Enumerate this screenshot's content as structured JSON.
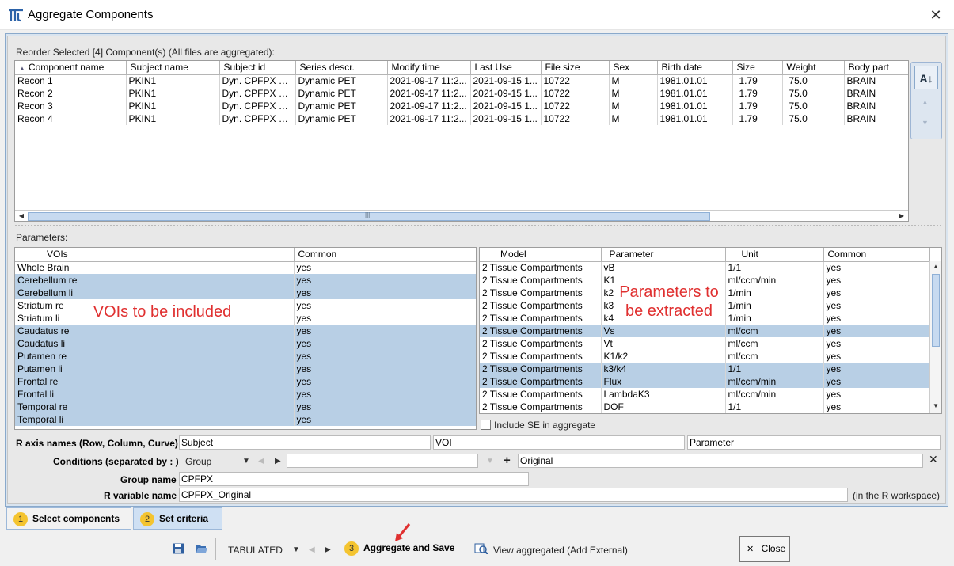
{
  "window": {
    "title": "Aggregate Components",
    "close_glyph": "✕"
  },
  "components": {
    "label": "Reorder Selected [4] Component(s) (All files are aggregated):",
    "columns": [
      "Component name",
      "Subject name",
      "Subject id",
      "Series descr.",
      "Modify time",
      "Last Use",
      "File size",
      "Sex",
      "Birth date",
      "Size",
      "Weight",
      "Body part"
    ],
    "rows": [
      [
        "Recon 1",
        "PKIN1",
        "Dyn. CPFPX bo...",
        "Dynamic PET",
        "2021-09-17 11:2...",
        "2021-09-15 1...",
        "10722",
        "M",
        "1981.01.01",
        "1.79",
        "75.0",
        "BRAIN"
      ],
      [
        "Recon 2",
        "PKIN1",
        "Dyn. CPFPX bo...",
        "Dynamic PET",
        "2021-09-17 11:2...",
        "2021-09-15 1...",
        "10722",
        "M",
        "1981.01.01",
        "1.79",
        "75.0",
        "BRAIN"
      ],
      [
        "Recon 3",
        "PKIN1",
        "Dyn. CPFPX bo...",
        "Dynamic PET",
        "2021-09-17 11:2...",
        "2021-09-15 1...",
        "10722",
        "M",
        "1981.01.01",
        "1.79",
        "75.0",
        "BRAIN"
      ],
      [
        "Recon 4",
        "PKIN1",
        "Dyn. CPFPX bo...",
        "Dynamic PET",
        "2021-09-17 11:2...",
        "2021-09-15 1...",
        "10722",
        "M",
        "1981.01.01",
        "1.79",
        "75.0",
        "BRAIN"
      ]
    ],
    "sort_indicator": "▲",
    "scroll_grip": "|||"
  },
  "params": {
    "label": "Parameters:",
    "vois": {
      "columns": [
        "VOIs",
        "Common"
      ],
      "rows": [
        {
          "name": "Whole Brain",
          "common": "yes",
          "selected": false
        },
        {
          "name": "Cerebellum re",
          "common": "yes",
          "selected": true
        },
        {
          "name": "Cerebellum li",
          "common": "yes",
          "selected": true
        },
        {
          "name": "Striatum re",
          "common": "yes",
          "selected": false
        },
        {
          "name": "Striatum li",
          "common": "yes",
          "selected": false
        },
        {
          "name": "Caudatus re",
          "common": "yes",
          "selected": true
        },
        {
          "name": "Caudatus li",
          "common": "yes",
          "selected": true
        },
        {
          "name": "Putamen re",
          "common": "yes",
          "selected": true
        },
        {
          "name": "Putamen li",
          "common": "yes",
          "selected": true
        },
        {
          "name": "Frontal re",
          "common": "yes",
          "selected": true
        },
        {
          "name": "Frontal li",
          "common": "yes",
          "selected": true
        },
        {
          "name": "Temporal re",
          "common": "yes",
          "selected": true
        },
        {
          "name": "Temporal li",
          "common": "yes",
          "selected": true
        }
      ]
    },
    "models": {
      "columns": [
        "Model",
        "Parameter",
        "Unit",
        "Common"
      ],
      "rows": [
        {
          "model": "2 Tissue Compartments",
          "parameter": "vB",
          "unit": "1/1",
          "common": "yes",
          "selected": false
        },
        {
          "model": "2 Tissue Compartments",
          "parameter": "K1",
          "unit": "ml/ccm/min",
          "common": "yes",
          "selected": false
        },
        {
          "model": "2 Tissue Compartments",
          "parameter": "k2",
          "unit": "1/min",
          "common": "yes",
          "selected": false
        },
        {
          "model": "2 Tissue Compartments",
          "parameter": "k3",
          "unit": "1/min",
          "common": "yes",
          "selected": false
        },
        {
          "model": "2 Tissue Compartments",
          "parameter": "k4",
          "unit": "1/min",
          "common": "yes",
          "selected": false
        },
        {
          "model": "2 Tissue Compartments",
          "parameter": "Vs",
          "unit": "ml/ccm",
          "common": "yes",
          "selected": true
        },
        {
          "model": "2 Tissue Compartments",
          "parameter": "Vt",
          "unit": "ml/ccm",
          "common": "yes",
          "selected": false
        },
        {
          "model": "2 Tissue Compartments",
          "parameter": "K1/k2",
          "unit": "ml/ccm",
          "common": "yes",
          "selected": false
        },
        {
          "model": "2 Tissue Compartments",
          "parameter": "k3/k4",
          "unit": "1/1",
          "common": "yes",
          "selected": true
        },
        {
          "model": "2 Tissue Compartments",
          "parameter": "Flux",
          "unit": "ml/ccm/min",
          "common": "yes",
          "selected": true
        },
        {
          "model": "2 Tissue Compartments",
          "parameter": "LambdaK3",
          "unit": "ml/ccm/min",
          "common": "yes",
          "selected": false
        },
        {
          "model": "2 Tissue Compartments",
          "parameter": "DOF",
          "unit": "1/1",
          "common": "yes",
          "selected": false
        }
      ]
    },
    "include_se_label": "Include SE in aggregate",
    "include_se_checked": false
  },
  "annotations": {
    "vois_note": "VOIs to be included",
    "params_note_line1": "Parameters to",
    "params_note_line2": "be extracted"
  },
  "form": {
    "axis_names_label": "R axis names (Row, Column, Curve)",
    "axis_row": "Subject",
    "axis_column": "VOI",
    "axis_curve": "Parameter",
    "conditions_label": "Conditions (separated by : )",
    "condition_type": "Group",
    "condition_value": "",
    "condition_text": "Original",
    "group_name_label": "Group name",
    "group_name": "CPFPX",
    "rvar_label": "R variable name",
    "rvar_name": "CPFPX_Original",
    "rvar_hint": "(in the R workspace)"
  },
  "tabs": [
    {
      "num": "1",
      "label": "Select components",
      "active": false
    },
    {
      "num": "2",
      "label": "Set criteria",
      "active": true
    }
  ],
  "toolbar": {
    "format": "TABULATED",
    "step_num": "3",
    "aggregate_label": "Aggregate and Save",
    "view_label": "View aggregated (Add External)",
    "close_label": "Close",
    "close_glyph": "✕"
  },
  "colors": {
    "selection": "#b8cfe5",
    "annotation": "#e03030",
    "badge": "#f4c430"
  },
  "icons": [
    "app-logo-icon",
    "sort-icon",
    "save-icon",
    "open-folder-icon",
    "view-aggregated-icon",
    "close-icon",
    "red-arrow-pointer"
  ]
}
